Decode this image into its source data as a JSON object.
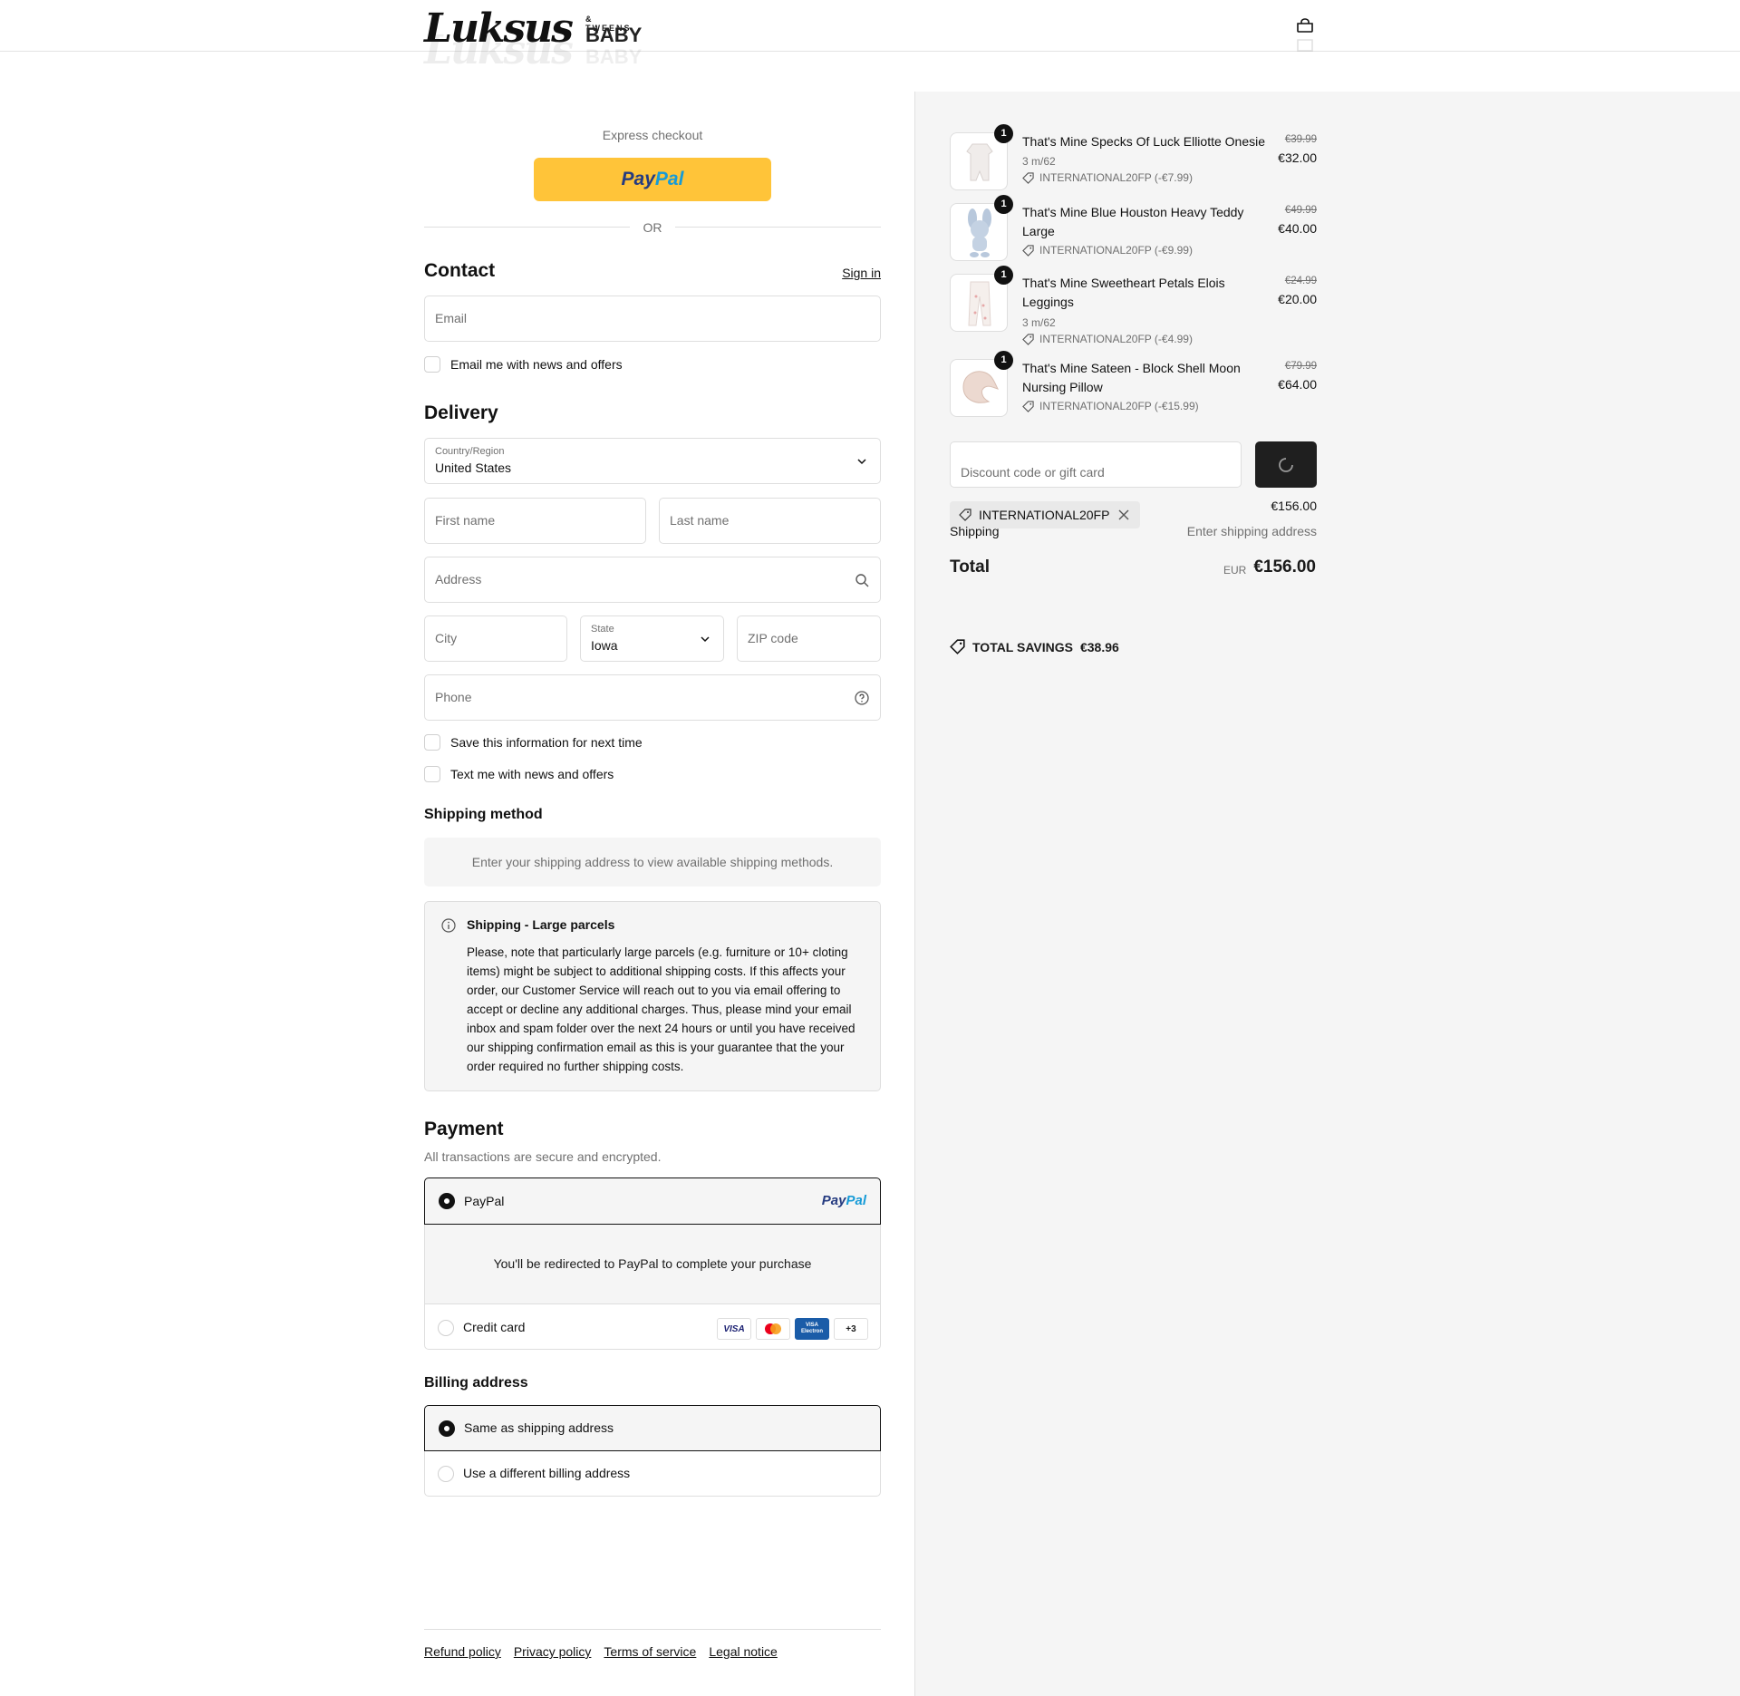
{
  "brand": {
    "script": "Luksus",
    "tweens": "& TWEENS",
    "baby": "BABY"
  },
  "express": {
    "label": "Express checkout",
    "paypal_part1": "Pay",
    "paypal_part2": "Pal",
    "or": "OR"
  },
  "contact": {
    "title": "Contact",
    "sign_in": "Sign in",
    "email_placeholder": "Email",
    "news_label": "Email me with news and offers"
  },
  "delivery": {
    "title": "Delivery",
    "country_label": "Country/Region",
    "country_value": "United States",
    "first_name": "First name",
    "last_name": "Last name",
    "address": "Address",
    "city": "City",
    "state_label": "State",
    "state_value": "Iowa",
    "zip": "ZIP code",
    "phone": "Phone",
    "save_info": "Save this information for next time",
    "text_news": "Text me with news and offers"
  },
  "shipping_method": {
    "title": "Shipping method",
    "message": "Enter your shipping address to view available shipping methods."
  },
  "notice": {
    "title": "Shipping - Large parcels",
    "body": "Please, note that particularly large parcels (e.g. furniture or 10+ cloting items) might be subject to additional shipping costs. If this affects your order, our Customer Service will reach out to you via email offering to accept or decline any additional charges. Thus, please mind your email inbox and spam folder over the next 24 hours or until you have received our shipping confirmation email as this is your guarantee that the your order required no further shipping costs."
  },
  "payment": {
    "title": "Payment",
    "subtitle": "All transactions are secure and encrypted.",
    "paypal_label": "PayPal",
    "paypal_logo1": "Pay",
    "paypal_logo2": "Pal",
    "redirect_msg": "You'll be redirected to PayPal to complete your purchase",
    "credit_label": "Credit card",
    "cards": {
      "visa": "VISA",
      "electron": "VISA Electron",
      "more": "+3"
    }
  },
  "billing": {
    "title": "Billing address",
    "same": "Same as shipping address",
    "different": "Use a different billing address"
  },
  "footer": {
    "links": [
      "Refund policy",
      "Privacy policy",
      "Terms of service",
      "Legal notice"
    ]
  },
  "cart": {
    "items": [
      {
        "name": "That's Mine Specks Of Luck Elliotte Onesie",
        "variant": "3 m/62",
        "discount": "INTERNATIONAL20FP (-€7.99)",
        "old_price": "€39.99",
        "price": "€32.00",
        "qty": "1"
      },
      {
        "name": "That's Mine Blue Houston Heavy Teddy Large",
        "variant": "",
        "discount": "INTERNATIONAL20FP (-€9.99)",
        "old_price": "€49.99",
        "price": "€40.00",
        "qty": "1"
      },
      {
        "name": "That's Mine Sweetheart Petals Elois Leggings",
        "variant": "3 m/62",
        "discount": "INTERNATIONAL20FP (-€4.99)",
        "old_price": "€24.99",
        "price": "€20.00",
        "qty": "1"
      },
      {
        "name": "That's Mine Sateen - Block Shell Moon Nursing Pillow",
        "variant": "",
        "discount": "INTERNATIONAL20FP (-€15.99)",
        "old_price": "€79.99",
        "price": "€64.00",
        "qty": "1"
      }
    ],
    "discount_placeholder": "Discount code or gift card",
    "applied_code": "INTERNATIONAL20FP",
    "subtotal_value": "€156.00",
    "shipping_label": "Shipping",
    "shipping_value": "Enter shipping address",
    "total_label": "Total",
    "currency": "EUR",
    "total_value": "€156.00",
    "savings_label": "TOTAL SAVINGS",
    "savings_value": "€38.96"
  },
  "colors": {
    "paypal_yellow": "#ffc439",
    "paypal_dark": "#253b80",
    "paypal_light": "#179bd7",
    "summary_bg": "#f5f5f5",
    "button_dark": "#1f1f1f"
  }
}
